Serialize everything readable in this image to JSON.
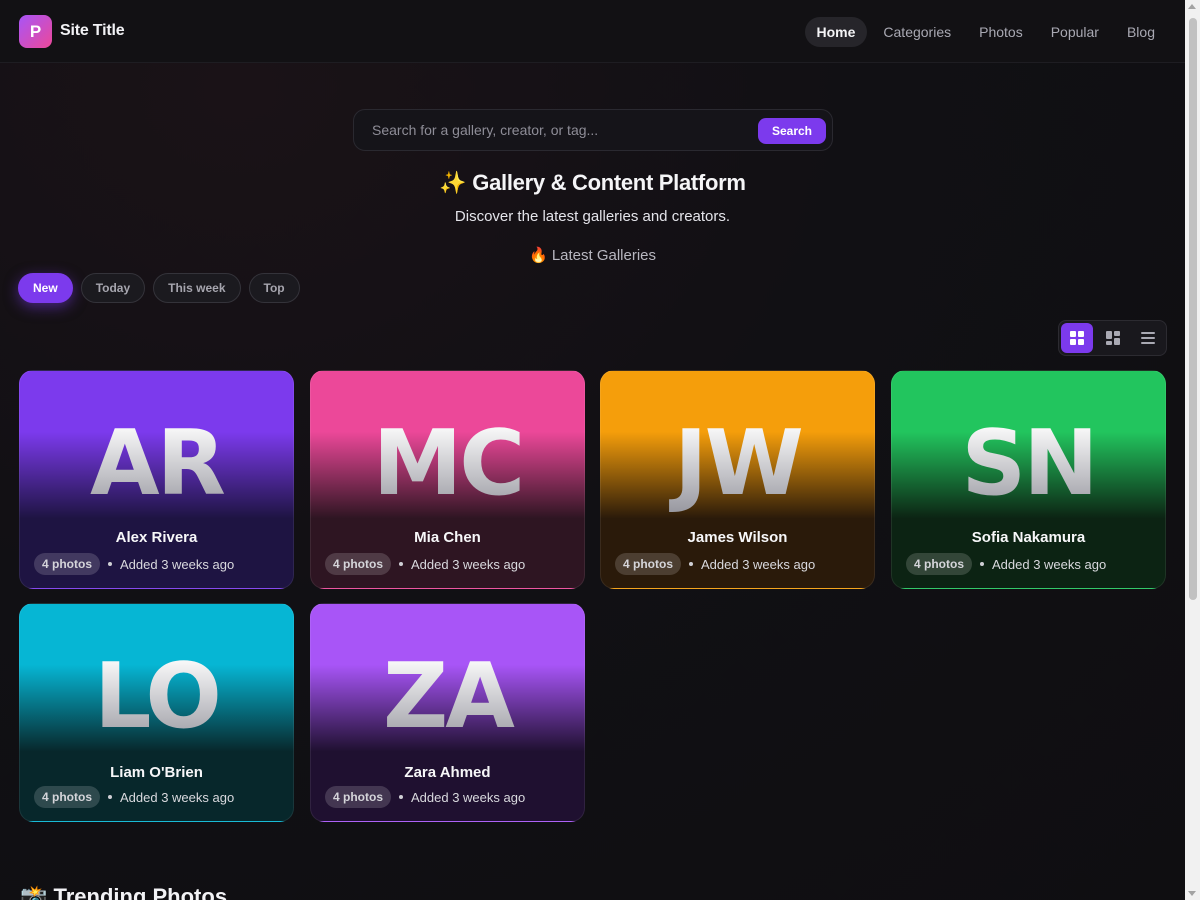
{
  "header": {
    "logo_letter": "P",
    "site_title": "Site Title",
    "nav": [
      {
        "label": "Home",
        "active": true
      },
      {
        "label": "Categories",
        "active": false
      },
      {
        "label": "Photos",
        "active": false
      },
      {
        "label": "Popular",
        "active": false
      },
      {
        "label": "Blog",
        "active": false
      }
    ]
  },
  "search": {
    "placeholder": "Search for a gallery, creator, or tag...",
    "button_label": "Search"
  },
  "hero": {
    "title": "✨ Gallery & Content Platform",
    "subtitle": "Discover the latest galleries and creators."
  },
  "section_label": "🔥 Latest Galleries",
  "filters": [
    {
      "label": "New",
      "active": true
    },
    {
      "label": "Today",
      "active": false
    },
    {
      "label": "This week",
      "active": false
    },
    {
      "label": "Top",
      "active": false
    }
  ],
  "view_modes": [
    {
      "icon": "grid-icon",
      "active": true
    },
    {
      "icon": "masonry-icon",
      "active": false
    },
    {
      "icon": "list-icon",
      "active": false
    }
  ],
  "galleries": [
    {
      "initials": "AR",
      "name": "Alex Rivera",
      "photos": "4 photos",
      "added": "Added 3 weeks ago",
      "color_top": "#7c3aed",
      "color_bottom": "#1e1442"
    },
    {
      "initials": "MC",
      "name": "Mia Chen",
      "photos": "4 photos",
      "added": "Added 3 weeks ago",
      "color_top": "#ec4899",
      "color_bottom": "#2e1522"
    },
    {
      "initials": "JW",
      "name": "James Wilson",
      "photos": "4 photos",
      "added": "Added 3 weeks ago",
      "color_top": "#f59e0b",
      "color_bottom": "#2a1a0a"
    },
    {
      "initials": "SN",
      "name": "Sofia Nakamura",
      "photos": "4 photos",
      "added": "Added 3 weeks ago",
      "color_top": "#22c55e",
      "color_bottom": "#0c2313"
    },
    {
      "initials": "LO",
      "name": "Liam O'Brien",
      "photos": "4 photos",
      "added": "Added 3 weeks ago",
      "color_top": "#06b6d4",
      "color_bottom": "#07272b"
    },
    {
      "initials": "ZA",
      "name": "Zara Ahmed",
      "photos": "4 photos",
      "added": "Added 3 weeks ago",
      "color_top": "#a855f7",
      "color_bottom": "#1f1030"
    }
  ],
  "trending_title": "📸 Trending Photos"
}
